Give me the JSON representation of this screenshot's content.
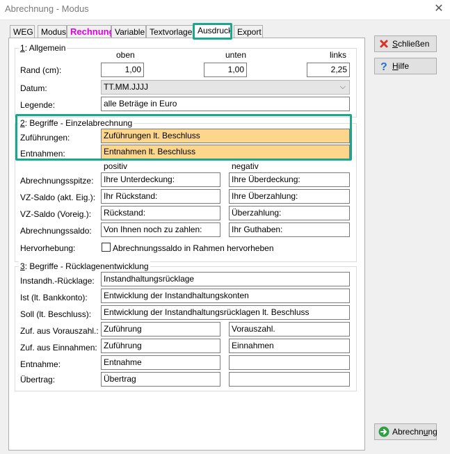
{
  "window": {
    "title": "Abrechnung - Modus",
    "close_glyph": "✕"
  },
  "tabs": [
    "WEG",
    "Modus",
    "Rechnung",
    "Variable",
    "Textvorlage",
    "Ausdruck",
    "Export"
  ],
  "section1": {
    "title_num": "1",
    "title_rest": ": Allgemein",
    "col_oben": "oben",
    "col_unten": "unten",
    "col_links": "links",
    "rand_label": "Rand (cm):",
    "rand_oben": "1,00",
    "rand_unten": "1,00",
    "rand_links": "2,25",
    "datum_label": "Datum:",
    "datum_value": "TT.MM.JJJJ",
    "legende_label": "Legende:",
    "legende_value": "alle Beträge in Euro"
  },
  "section2": {
    "title_num": "2",
    "title_rest": ": Begriffe - Einzelabrechnung",
    "zuf_label": "Zuführungen:",
    "zuf_value": "Zuführungen lt. Beschluss",
    "ent_label": "Entnahmen:",
    "ent_value": "Entnahmen lt. Beschluss",
    "col_positiv": "positiv",
    "col_negativ": "negativ",
    "rows": [
      {
        "label": "Abrechnungsspitze:",
        "pos": "Ihre Unterdeckung:",
        "neg": "Ihre Überdeckung:"
      },
      {
        "label": "VZ-Saldo (akt. Eig.):",
        "pos": "Ihr Rückstand:",
        "neg": "Ihre Überzahlung:"
      },
      {
        "label": "VZ-Saldo (Voreig.):",
        "pos": "Rückstand:",
        "neg": "Überzahlung:"
      },
      {
        "label": "Abrechnungssaldo:",
        "pos": "Von Ihnen noch zu zahlen:",
        "neg": "Ihr Guthaben:"
      }
    ],
    "hervor_label": "Hervorhebung:",
    "hervor_checkbox": "Abrechnungssaldo in Rahmen hervorheben"
  },
  "section3": {
    "title_num": "3",
    "title_rest": ": Begriffe - Rücklagenentwicklung",
    "rows": [
      {
        "label": "Instandh.-Rücklage:",
        "value": "Instandhaltungsrücklage"
      },
      {
        "label": "Ist (lt. Bankkonto):",
        "value": "Entwicklung der Instandhaltungskonten"
      },
      {
        "label": "Soll (lt. Beschluss):",
        "value": "Entwicklung der Instandhaltungsrücklagen lt. Beschluss"
      }
    ],
    "pair_rows": [
      {
        "label": "Zuf. aus Vorauszahl.:",
        "a": "Zuführung",
        "b": "Vorauszahl."
      },
      {
        "label": "Zuf. aus Einnahmen:",
        "a": "Zuführung",
        "b": "Einnahmen"
      },
      {
        "label": "Entnahme:",
        "a": "Entnahme",
        "b": ""
      },
      {
        "label": "Übertrag:",
        "a": "Übertrag",
        "b": ""
      }
    ]
  },
  "buttons": {
    "close_mnemonic": "S",
    "close_rest": "chließen",
    "help_mnemonic": "H",
    "help_rest": "ilfe",
    "abrechnung_pre": "Abrechn",
    "abrechnung_mnemonic": "u",
    "abrechnung_post": "ng"
  },
  "icons": {
    "close": "x-red-icon",
    "help": "question-blue-icon",
    "abrechnung": "arrow-right-green-icon"
  },
  "colors": {
    "highlight_border": "#1aa78c",
    "yellow_field": "#fcd68b",
    "rechnung_tab": "#e000e0"
  }
}
